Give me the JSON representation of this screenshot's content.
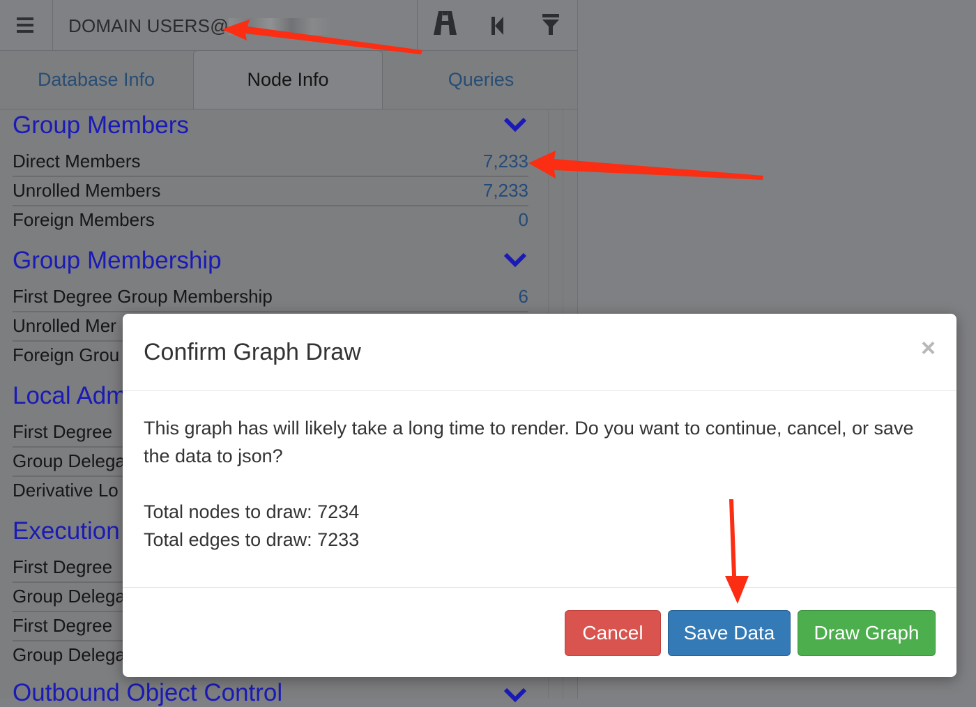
{
  "header": {
    "search_text": "DOMAIN USERS@",
    "icons": [
      "menu-icon",
      "pathfinding-icon",
      "back-icon",
      "filter-icon"
    ]
  },
  "tabs": [
    {
      "label": "Database Info"
    },
    {
      "label": "Node Info"
    },
    {
      "label": "Queries"
    }
  ],
  "sections": [
    {
      "title": "Group Members",
      "rows": [
        {
          "label": "Direct Members",
          "value": "7,233"
        },
        {
          "label": "Unrolled Members",
          "value": "7,233"
        },
        {
          "label": "Foreign Members",
          "value": "0"
        }
      ]
    },
    {
      "title": "Group Membership",
      "rows": [
        {
          "label": "First Degree Group Membership",
          "value": "6"
        },
        {
          "label": "Unrolled Mer",
          "value": ""
        },
        {
          "label": "Foreign Grou",
          "value": ""
        }
      ]
    },
    {
      "title": "Local Adm",
      "rows": [
        {
          "label": "First Degree",
          "value": ""
        },
        {
          "label": "Group Delega",
          "value": ""
        },
        {
          "label": "Derivative Lo",
          "value": ""
        }
      ]
    },
    {
      "title": "Execution",
      "rows": [
        {
          "label": "First Degree",
          "value": ""
        },
        {
          "label": "Group Delega",
          "value": ""
        },
        {
          "label": "First Degree",
          "value": ""
        },
        {
          "label": "Group Delega",
          "value": ""
        }
      ]
    },
    {
      "title": "Outbound Object Control",
      "rows": []
    }
  ],
  "modal": {
    "title": "Confirm Graph Draw",
    "close": "×",
    "message": "This graph has will likely take a long time to render. Do you want to continue, cancel, or save the data to json?",
    "nodes_line": "Total nodes to draw: 7234",
    "edges_line": "Total edges to draw: 7233",
    "buttons": {
      "cancel": "Cancel",
      "save": "Save Data",
      "draw": "Draw Graph"
    }
  },
  "colors": {
    "section_title": "#1a1ab6",
    "value": "#244a78",
    "cancel": "#d9534f",
    "save": "#337ab7",
    "draw": "#4cae4c",
    "annotation_arrow": "#fb2d13"
  }
}
